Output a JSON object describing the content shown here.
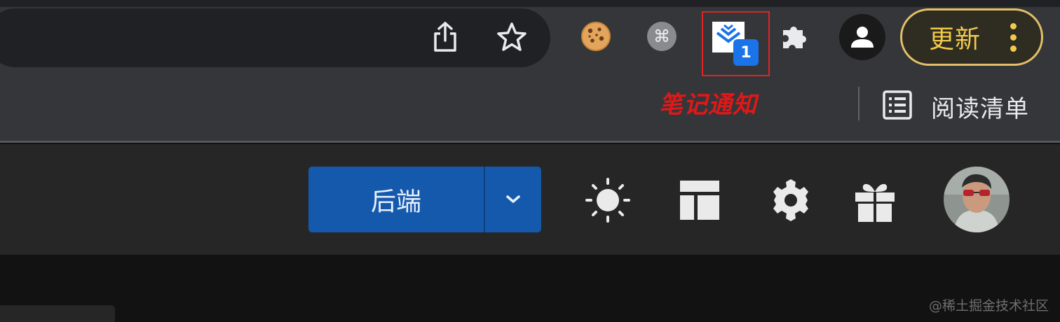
{
  "browser": {
    "toolbar": {
      "share_icon": "share-icon",
      "bookmark_icon": "star-icon",
      "extensions": [
        {
          "name": "cookie-extension",
          "icon": "cookie-icon"
        },
        {
          "name": "shortcut-extension",
          "icon": "command-icon"
        },
        {
          "name": "notes-extension",
          "icon": "layers-check-icon",
          "badge": "1"
        },
        {
          "name": "extensions-menu",
          "icon": "puzzle-icon"
        }
      ],
      "profile_icon": "person-icon",
      "update_label": "更新"
    },
    "annotation": "笔记通知",
    "annotation_color": "#e01818",
    "bookmarks_bar": {
      "reading_list_label": "阅读清单",
      "reading_list_icon": "list-icon"
    }
  },
  "page": {
    "header": {
      "category_label": "后端",
      "category_dropdown_icon": "chevron-down-icon",
      "icons": [
        "sun-icon",
        "layout-icon",
        "gear-icon",
        "gift-icon"
      ],
      "avatar": "user-avatar"
    },
    "watermark": "@稀土掘金技术社区"
  },
  "colors": {
    "accent": "#1559ac",
    "badge": "#1a73e8",
    "update": "#f2c94c"
  }
}
